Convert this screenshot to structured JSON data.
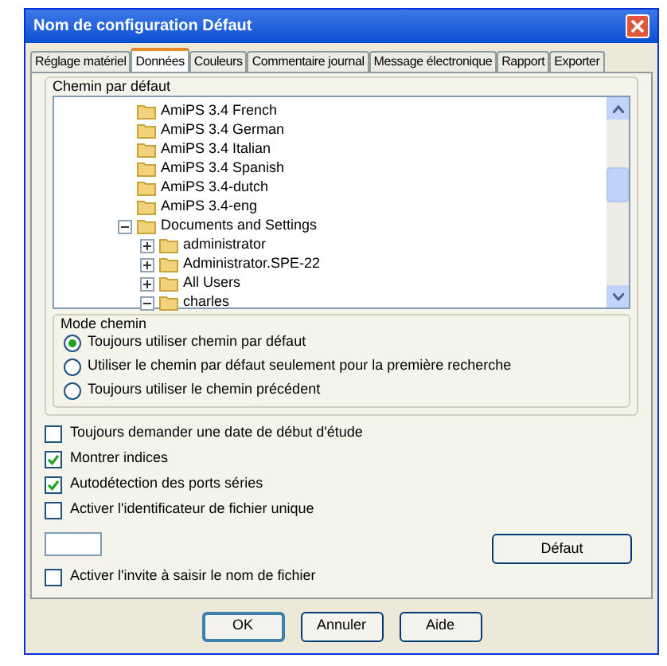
{
  "window": {
    "title": "Nom de configuration Défaut"
  },
  "tabs": [
    {
      "label": "Réglage matériel",
      "selected": false
    },
    {
      "label": "Données",
      "selected": true
    },
    {
      "label": "Couleurs",
      "selected": false
    },
    {
      "label": "Commentaire journal",
      "selected": false
    },
    {
      "label": "Message électronique",
      "selected": false
    },
    {
      "label": "Rapport",
      "selected": false
    },
    {
      "label": "Exporter",
      "selected": false
    }
  ],
  "default_path": {
    "title": "Chemin par défaut",
    "tree": [
      {
        "label": "AmiPS 3.4 French",
        "kind": "leaf"
      },
      {
        "label": "AmiPS 3.4 German",
        "kind": "leaf"
      },
      {
        "label": "AmiPS 3.4 Italian",
        "kind": "leaf"
      },
      {
        "label": "AmiPS 3.4 Spanish",
        "kind": "leaf"
      },
      {
        "label": "AmiPS 3.4-dutch",
        "kind": "leaf"
      },
      {
        "label": "AmiPS 3.4-eng",
        "kind": "leaf"
      },
      {
        "label": "Documents and Settings",
        "kind": "node",
        "expanded": true,
        "children": [
          {
            "label": "administrator",
            "kind": "node",
            "expanded": false
          },
          {
            "label": "Administrator.SPE-22",
            "kind": "node",
            "expanded": false
          },
          {
            "label": "All Users",
            "kind": "node",
            "expanded": false
          },
          {
            "label": "charles",
            "kind": "node",
            "expanded": true
          }
        ]
      }
    ]
  },
  "path_mode": {
    "title": "Mode chemin",
    "options": [
      {
        "label": "Toujours utiliser chemin par défaut",
        "selected": true
      },
      {
        "label": "Utiliser le chemin par défaut seulement pour la première recherche",
        "selected": false
      },
      {
        "label": "Toujours utiliser le chemin précédent",
        "selected": false
      }
    ]
  },
  "options_top": [
    {
      "label": "Toujours demander une date de début d'étude",
      "checked": false
    },
    {
      "label": "Montrer indices",
      "checked": true
    },
    {
      "label": "Autodétection des ports séries",
      "checked": true
    },
    {
      "label": "Activer l'identificateur de fichier unique",
      "checked": false
    }
  ],
  "default_button": "Défaut",
  "options_bottom": [
    {
      "label": "Activer l'invite à saisir le nom de fichier",
      "checked": false
    }
  ],
  "buttons": [
    {
      "label": "OK",
      "default": true
    },
    {
      "label": "Annuler",
      "default": false
    },
    {
      "label": "Aide",
      "default": false
    }
  ]
}
